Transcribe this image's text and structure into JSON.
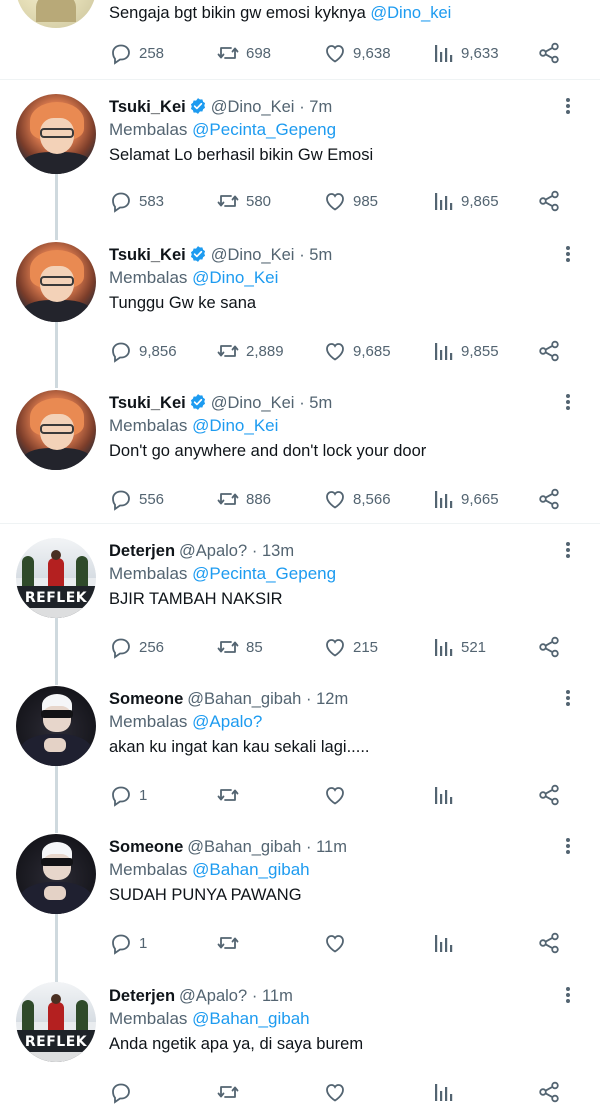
{
  "top_tweet": {
    "text_prefix": "Sengaja bgt bikin gw emosi kyknya ",
    "text_mention": "@Dino_kei",
    "replies": "258",
    "retweets": "698",
    "likes": "9,638",
    "views": "9,633"
  },
  "tweets": [
    {
      "name": "Tsuki_Kei",
      "handle": "@Dino_Kei",
      "time": "· 7m",
      "reply_prefix": "Membalas ",
      "reply_to": "@Pecinta_Gepeng",
      "text": "Selamat Lo berhasil bikin Gw Emosi",
      "replies": "583",
      "retweets": "580",
      "likes": "985",
      "views": "9,865"
    },
    {
      "name": "Tsuki_Kei",
      "handle": "@Dino_Kei",
      "time": "· 5m",
      "reply_prefix": "Membalas ",
      "reply_to": "@Dino_Kei",
      "text": "Tunggu Gw ke sana",
      "replies": "9,856",
      "retweets": "2,889",
      "likes": "9,685",
      "views": "9,855"
    },
    {
      "name": "Tsuki_Kei",
      "handle": "@Dino_Kei",
      "time": "· 5m",
      "reply_prefix": "Membalas ",
      "reply_to": "@Dino_Kei",
      "text": "Don't go anywhere and don't lock your door",
      "replies": "556",
      "retweets": "886",
      "likes": "8,566",
      "views": "9,665"
    },
    {
      "name": "Deterjen",
      "handle": "@Apalo?",
      "time": "· 13m",
      "reply_prefix": "Membalas ",
      "reply_to": "@Pecinta_Gepeng",
      "text": "BJIR TAMBAH NAKSIR",
      "replies": "256",
      "retweets": "85",
      "likes": "215",
      "views": "521",
      "avatar_text": "REFLEK"
    },
    {
      "name": "Someone",
      "handle": "@Bahan_gibah",
      "time": "· 12m",
      "reply_prefix": "Membalas ",
      "reply_to": "@Apalo?",
      "text": "akan ku ingat kan kau sekali lagi.....",
      "replies": "1",
      "retweets": "",
      "likes": "",
      "views": ""
    },
    {
      "name": "Someone",
      "handle": "@Bahan_gibah",
      "time": "· 11m",
      "reply_prefix": "Membalas ",
      "reply_to": "@Bahan_gibah",
      "text": "SUDAH PUNYA PAWANG",
      "replies": "1",
      "retweets": "",
      "likes": "",
      "views": ""
    },
    {
      "name": "Deterjen",
      "handle": "@Apalo?",
      "time": "· 11m",
      "reply_prefix": "Membalas ",
      "reply_to": "@Bahan_gibah",
      "text": "Anda ngetik apa ya, di saya burem",
      "replies": "",
      "retweets": "",
      "likes": "",
      "views": "",
      "avatar_text": "REFLEK"
    }
  ],
  "colors": {
    "accent": "#1d9bf0",
    "secondary_text": "#536471",
    "primary_text": "#0f1419",
    "divider": "#eff3f4"
  },
  "icons": [
    "reply-icon",
    "retweet-icon",
    "like-icon",
    "views-icon",
    "share-icon",
    "verified-icon",
    "more-icon"
  ]
}
